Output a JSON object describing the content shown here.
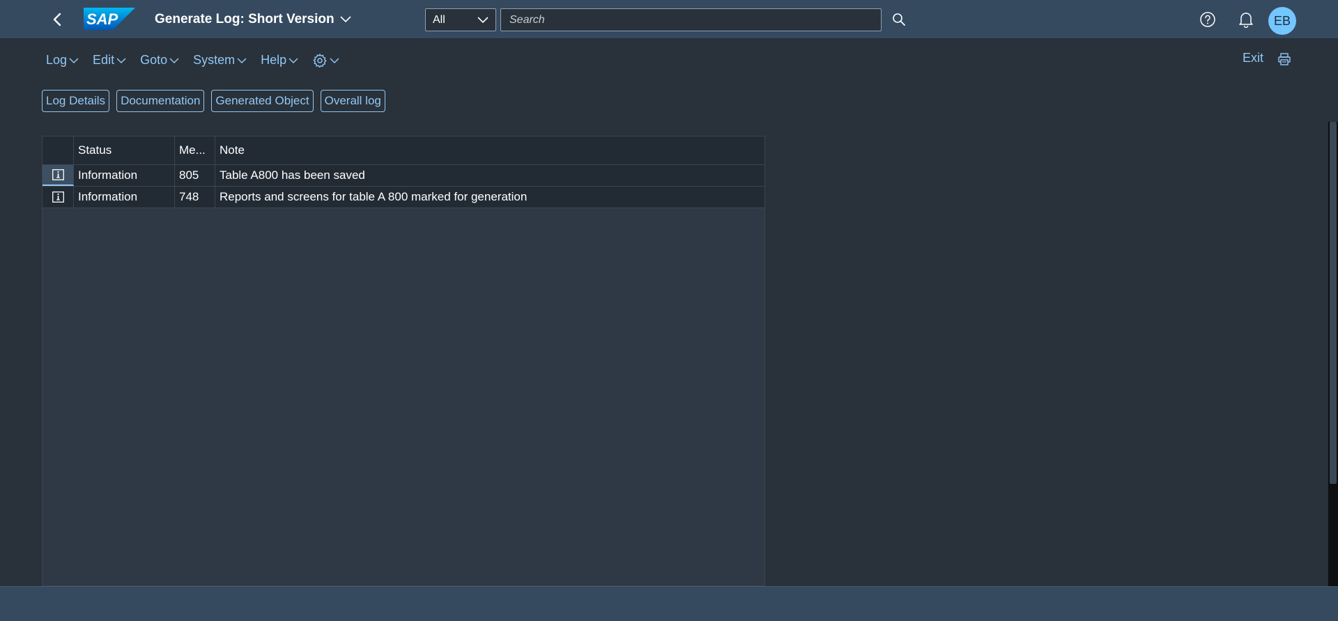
{
  "shell": {
    "logo_text": "SAP",
    "title": "Generate Log: Short Version",
    "scope": "All",
    "search_placeholder": "Search",
    "user_initials": "EB"
  },
  "menu": {
    "items": [
      "Log",
      "Edit",
      "Goto",
      "System",
      "Help"
    ],
    "exit_label": "Exit"
  },
  "toolbar": {
    "buttons": [
      "Log Details",
      "Documentation",
      "Generated Object",
      "Overall log"
    ]
  },
  "table": {
    "columns": [
      "Status",
      "Me...",
      "Note"
    ],
    "rows": [
      {
        "status": "Information",
        "message": "805",
        "note": "Table A800 has been saved"
      },
      {
        "status": "Information",
        "message": "748",
        "note": "Reports and screens for table A 800 marked for generation"
      }
    ]
  },
  "colors": {
    "shell_bg": "#354a5f",
    "page_bg": "#29313a",
    "link": "#91c8f6",
    "avatar": "#74c6ff"
  }
}
